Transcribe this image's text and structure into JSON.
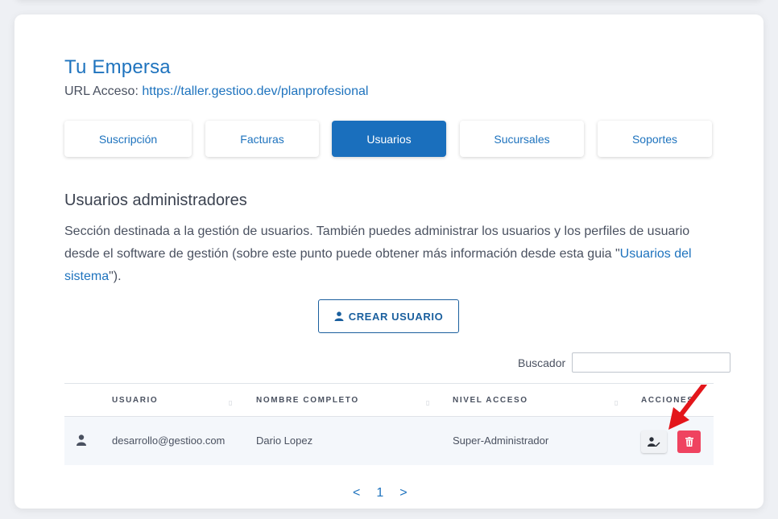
{
  "company": {
    "name": "Tu Empersa",
    "url_label": "URL Acceso: ",
    "url": "https://taller.gestioo.dev/planprofesional"
  },
  "tabs": [
    {
      "label": "Suscripción"
    },
    {
      "label": "Facturas"
    },
    {
      "label": "Usuarios"
    },
    {
      "label": "Sucursales"
    },
    {
      "label": "Soportes"
    }
  ],
  "section": {
    "title": "Usuarios administradores",
    "desc_part1": "Sección destinada a la gestión de usuarios. También puedes administrar los usuarios y los perfiles de usuario desde el software de gestión (sobre este punto puede obtener más información desde esta guia \"",
    "desc_link": "Usuarios del sistema",
    "desc_part2": "\")."
  },
  "create_button": "CREAR USUARIO",
  "search": {
    "label": "Buscador",
    "value": ""
  },
  "table": {
    "headers": [
      "USUARIO",
      "NOMBRE COMPLETO",
      "NIVEL ACCESO",
      "ACCIONES"
    ],
    "rows": [
      {
        "usuario": "desarrollo@gestioo.com",
        "nombre": "Dario Lopez",
        "nivel": "Super-Administrador"
      }
    ]
  },
  "pager": {
    "prev": "<",
    "page": "1",
    "next": ">"
  },
  "colors": {
    "accent": "#1e73be",
    "active_tab": "#1a6fbd",
    "delete": "#ef4360",
    "annotation": "#e3161b"
  }
}
